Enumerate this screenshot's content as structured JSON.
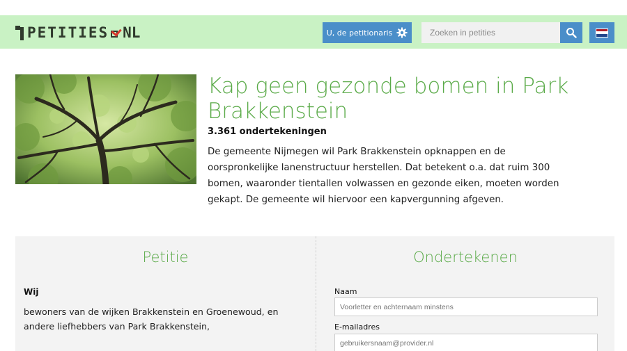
{
  "header": {
    "logo_text": "PETITIES",
    "logo_suffix": "NL",
    "petitioner_button": "U, de petitionaris",
    "search_placeholder": "Zoeken in petities",
    "colors": {
      "header_bg": "#c9f2c4",
      "accent_blue": "#4a8ec9",
      "logo_dark": "#2f3a2c",
      "logo_red": "#d9352c"
    }
  },
  "petition": {
    "title": "Kap geen gezonde bomen in Park Brakkenstein",
    "signatures": "3.361 ondertekeningen",
    "description": "De gemeente Nijmegen wil Park Brakkenstein opknappen en de oorspronkelijke lanenstructuur herstellen. Dat betekent o.a. dat ruim 300 bomen, waaronder tientallen volwassen en gezonde eiken, moeten worden gekapt. De gemeente wil hiervoor een kapvergunning afgeven.",
    "title_color": "#5aaa48"
  },
  "petition_panel": {
    "heading": "Petitie",
    "wij": "Wij",
    "text": "bewoners van de wijken Brakkenstein en Groenewoud, en andere liefhebbers van Park Brakkenstein,"
  },
  "sign_panel": {
    "heading": "Ondertekenen",
    "name_label": "Naam",
    "name_placeholder": "Voorletter en achternaam minstens",
    "email_label": "E-mailadres",
    "email_placeholder": "gebruikersnaam@provider.nl"
  },
  "icons": [
    "logo-figure-icon",
    "checkbox-logo-icon",
    "gear-icon",
    "search-icon",
    "dutch-flag-icon",
    "tree-photo"
  ]
}
